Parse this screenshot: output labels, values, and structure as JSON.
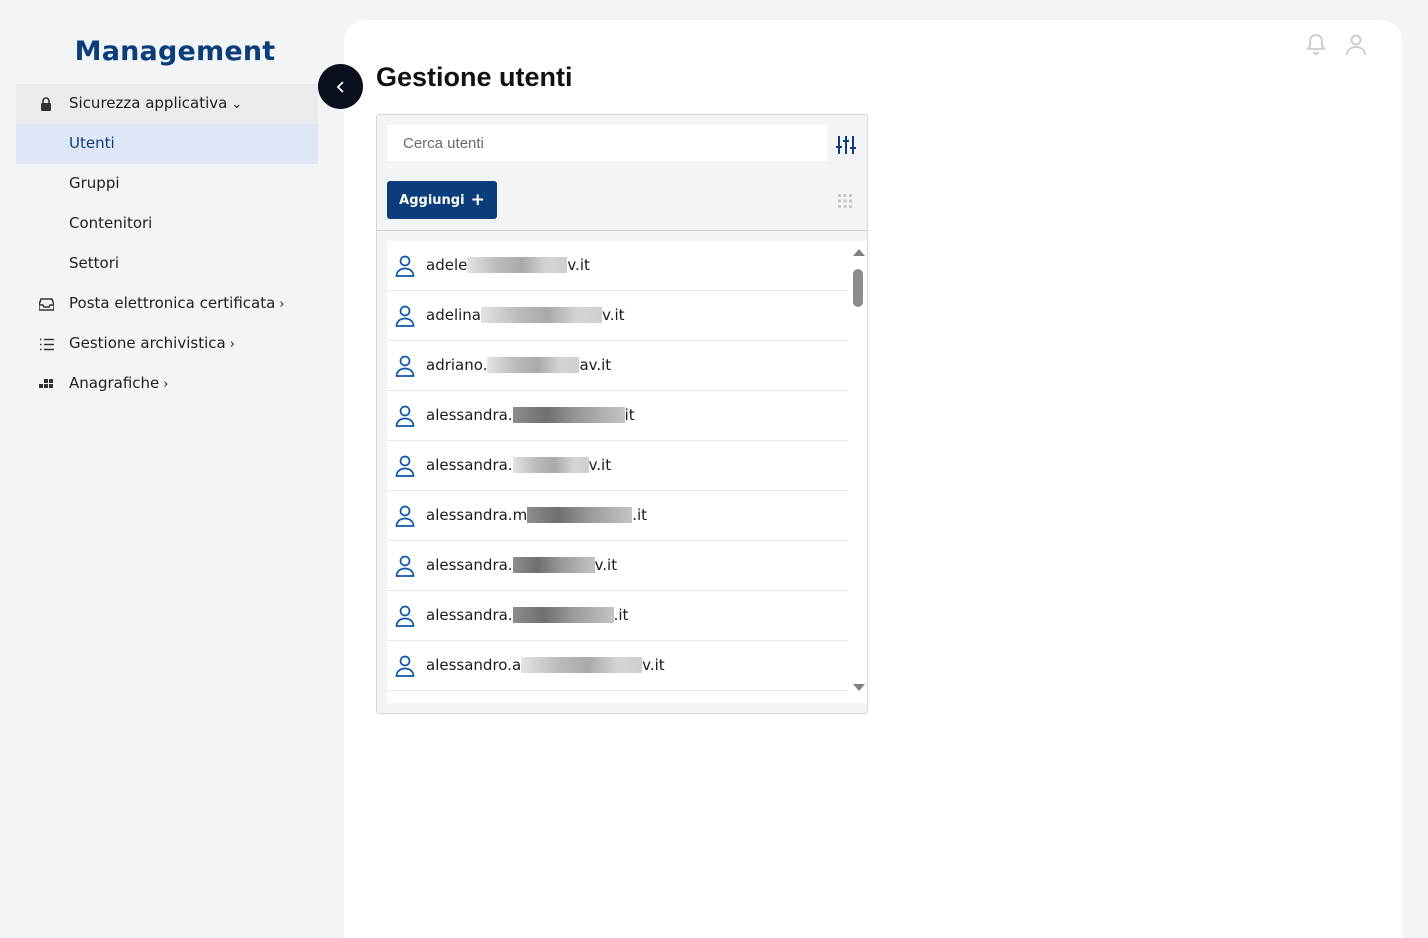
{
  "app": {
    "title": "Management"
  },
  "sidebar": {
    "items": [
      {
        "label": "Sicurezza applicativa",
        "icon": "lock-icon",
        "chevron": "⌄"
      },
      {
        "label": "Utenti"
      },
      {
        "label": "Gruppi"
      },
      {
        "label": "Contenitori"
      },
      {
        "label": "Settori"
      },
      {
        "label": "Posta elettronica certificata",
        "icon": "inbox-icon",
        "chevron": "›"
      },
      {
        "label": "Gestione archivistica",
        "icon": "list-icon",
        "chevron": "›"
      },
      {
        "label": "Anagrafiche",
        "icon": "widgets-icon",
        "chevron": "›"
      }
    ]
  },
  "header": {
    "title": "Gestione utenti",
    "icons": [
      "bell-icon",
      "user-profile-icon"
    ]
  },
  "search": {
    "placeholder": "Cerca utenti",
    "value": ""
  },
  "toolbar": {
    "add_label": "Aggiungi",
    "add_icon": "+"
  },
  "users": [
    {
      "prefix": "adele",
      "suffix": "v.it"
    },
    {
      "prefix": "adelina",
      "suffix": "v.it"
    },
    {
      "prefix": "adriano.",
      "suffix": "av.it"
    },
    {
      "prefix": "alessandra.",
      "suffix": "it"
    },
    {
      "prefix": "alessandra.",
      "suffix": "v.it"
    },
    {
      "prefix": "alessandra.m",
      "suffix": ".it"
    },
    {
      "prefix": "alessandra.",
      "suffix": "v.it"
    },
    {
      "prefix": "alessandra.",
      "suffix": ".it"
    },
    {
      "prefix": "alessandro.a",
      "suffix": "v.it"
    }
  ],
  "colors": {
    "brand": "#0b3d7a",
    "active_bg": "#dfe7f7",
    "page_bg": "#f3f4f6"
  }
}
